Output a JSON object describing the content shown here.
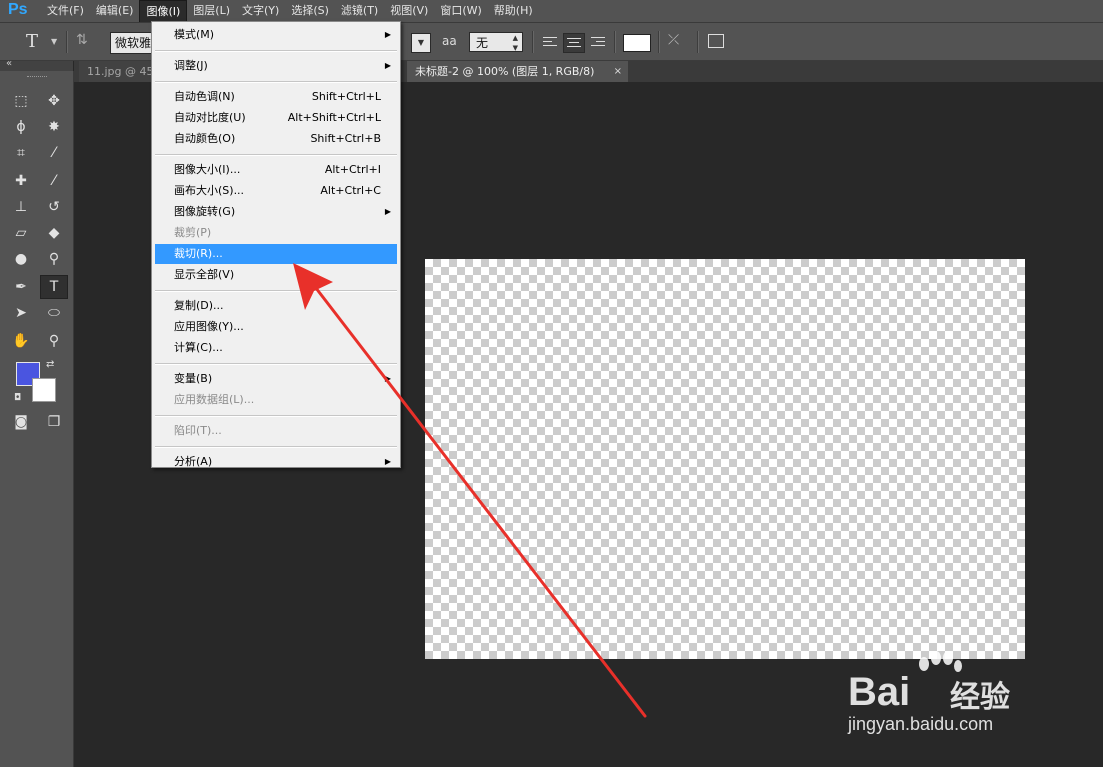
{
  "app": {
    "logo": "Ps"
  },
  "menubar": {
    "items": [
      "文件(F)",
      "编辑(E)",
      "图像(I)",
      "图层(L)",
      "文字(Y)",
      "选择(S)",
      "滤镜(T)",
      "视图(V)",
      "窗口(W)",
      "帮助(H)"
    ],
    "active_index": 2
  },
  "options": {
    "tool_glyph": "T",
    "font_family": "微软雅黑",
    "antialias_icon": "aa",
    "antialias_value": "无",
    "text_color": "#ffffff"
  },
  "tabs": [
    {
      "label": "11.jpg @ 45"
    },
    {
      "label": "未标题-2 @ 100% (图层 1, RGB/8)",
      "close": "×",
      "active": true
    }
  ],
  "colors": {
    "foreground": "#4a55e0",
    "background": "#ffffff",
    "highlight": "#3399ff",
    "arrow": "#e8302a"
  },
  "image_menu": {
    "items": [
      {
        "label": "模式(M)",
        "submenu": true
      },
      {
        "separator": true
      },
      {
        "label": "调整(J)",
        "submenu": true
      },
      {
        "separator": true
      },
      {
        "label": "自动色调(N)",
        "shortcut": "Shift+Ctrl+L"
      },
      {
        "label": "自动对比度(U)",
        "shortcut": "Alt+Shift+Ctrl+L"
      },
      {
        "label": "自动颜色(O)",
        "shortcut": "Shift+Ctrl+B"
      },
      {
        "separator": true
      },
      {
        "label": "图像大小(I)...",
        "shortcut": "Alt+Ctrl+I"
      },
      {
        "label": "画布大小(S)...",
        "shortcut": "Alt+Ctrl+C"
      },
      {
        "label": "图像旋转(G)",
        "submenu": true
      },
      {
        "label": "裁剪(P)",
        "disabled": true
      },
      {
        "label": "裁切(R)...",
        "highlighted": true
      },
      {
        "label": "显示全部(V)"
      },
      {
        "separator": true
      },
      {
        "label": "复制(D)..."
      },
      {
        "label": "应用图像(Y)..."
      },
      {
        "label": "计算(C)..."
      },
      {
        "separator": true
      },
      {
        "label": "变量(B)",
        "submenu": true
      },
      {
        "label": "应用数据组(L)...",
        "disabled": true
      },
      {
        "separator": true
      },
      {
        "label": "陷印(T)...",
        "disabled": true
      },
      {
        "separator": true
      },
      {
        "label": "分析(A)",
        "submenu": true
      }
    ]
  },
  "watermark": {
    "brand": "Bai",
    "brand_suffix": "经验",
    "url": "jingyan.baidu.com"
  }
}
